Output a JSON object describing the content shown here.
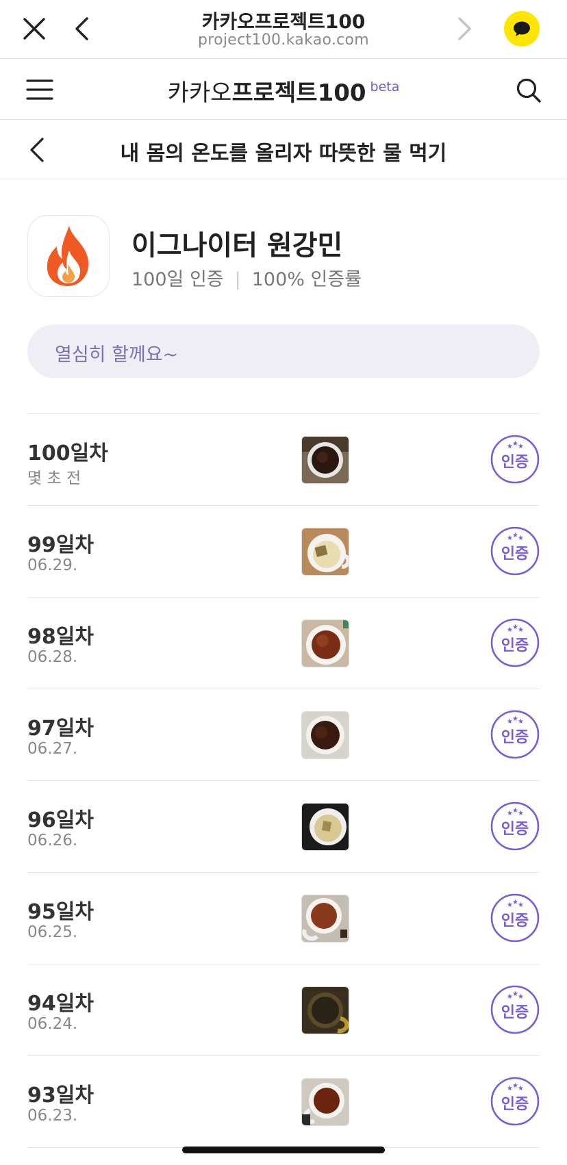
{
  "browser": {
    "title": "카카오프로젝트100",
    "url": "project100.kakao.com",
    "close_icon": "close-icon",
    "back_icon": "chevron-left-icon",
    "forward_icon": "chevron-right-icon",
    "talk_icon": "kakaotalk-bubble-icon"
  },
  "header": {
    "logo_regular": "카카오",
    "logo_bold": "프로젝트100",
    "logo_beta": "beta",
    "menu_icon": "hamburger-icon",
    "search_icon": "search-icon"
  },
  "page": {
    "title": "내 몸의 온도를 올리자 따뜻한 물 먹기"
  },
  "profile": {
    "name": "이그나이터 원강민",
    "days_label": "100일 인증",
    "rate_label": "100% 인증률",
    "icon": "flame-icon"
  },
  "message": "열심히 할께요~",
  "entries": [
    {
      "day": "100일차",
      "date": "몇 초 전",
      "stamp": "인증"
    },
    {
      "day": "99일차",
      "date": "06.29.",
      "stamp": "인증"
    },
    {
      "day": "98일차",
      "date": "06.28.",
      "stamp": "인증"
    },
    {
      "day": "97일차",
      "date": "06.27.",
      "stamp": "인증"
    },
    {
      "day": "96일차",
      "date": "06.26.",
      "stamp": "인증"
    },
    {
      "day": "95일차",
      "date": "06.25.",
      "stamp": "인증"
    },
    {
      "day": "94일차",
      "date": "06.24.",
      "stamp": "인증"
    },
    {
      "day": "93일차",
      "date": "06.23.",
      "stamp": "인증"
    }
  ],
  "colors": {
    "accent_purple": "#7a5cd6",
    "kakao_yellow": "#FEE500",
    "message_bg": "#efeef5"
  }
}
